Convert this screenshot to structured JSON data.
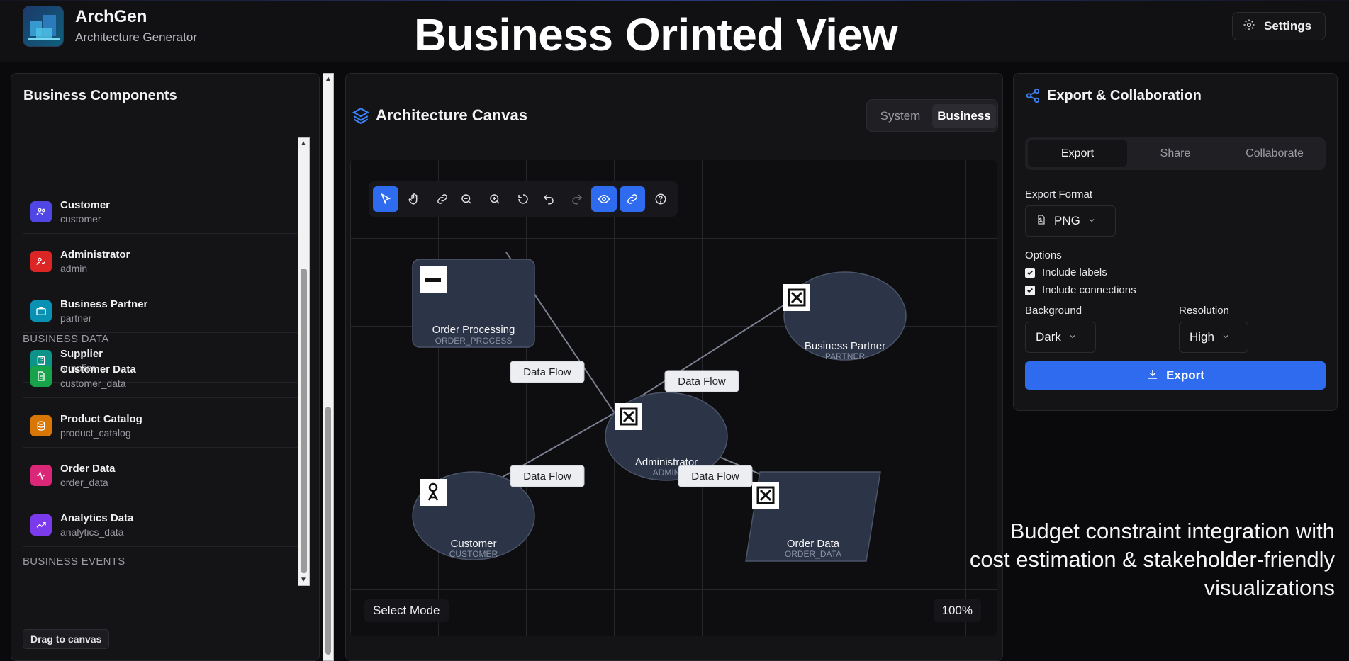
{
  "header": {
    "app_name": "ArchGen",
    "app_subtitle": "Architecture Generator",
    "hero_title": "Business Orinted View",
    "settings_label": "Settings"
  },
  "left_panel": {
    "title": "Business Components",
    "items": [
      {
        "name": "Customer",
        "id": "customer",
        "icon": "users-icon",
        "color": "#4f46e5"
      },
      {
        "name": "Administrator",
        "id": "admin",
        "icon": "user-check-icon",
        "color": "#dc2626"
      },
      {
        "name": "Business Partner",
        "id": "partner",
        "icon": "briefcase-icon",
        "color": "#0891b2"
      },
      {
        "name": "Supplier",
        "id": "supplier",
        "icon": "building-icon",
        "color": "#0d9488"
      }
    ],
    "data_section_label": "BUSINESS DATA",
    "data_items": [
      {
        "name": "Customer Data",
        "id": "customer_data",
        "icon": "file-icon",
        "color": "#16a34a"
      },
      {
        "name": "Product Catalog",
        "id": "product_catalog",
        "icon": "database-icon",
        "color": "#d97706"
      },
      {
        "name": "Order Data",
        "id": "order_data",
        "icon": "activity-icon",
        "color": "#db2777"
      },
      {
        "name": "Analytics Data",
        "id": "analytics_data",
        "icon": "trending-up-icon",
        "color": "#7c3aed"
      }
    ],
    "events_section_label": "BUSINESS EVENTS",
    "drag_hint": "Drag to canvas"
  },
  "canvas": {
    "title": "Architecture Canvas",
    "view_options": [
      "System",
      "Business"
    ],
    "active_view": "Business",
    "mode_label": "Select Mode",
    "zoom_label": "100%",
    "nodes": [
      {
        "label": "Order Processing",
        "sub": "ORDER_PROCESS",
        "shape": "rectangle"
      },
      {
        "label": "Business Partner",
        "sub": "PARTNER",
        "shape": "ellipse"
      },
      {
        "label": "Administrator",
        "sub": "ADMIN",
        "shape": "ellipse"
      },
      {
        "label": "Customer",
        "sub": "CUSTOMER",
        "shape": "ellipse"
      },
      {
        "label": "Order Data",
        "sub": "ORDER_DATA",
        "shape": "parallelogram"
      }
    ],
    "edge_label": "Data Flow"
  },
  "right_panel": {
    "title": "Export & Collaboration",
    "tabs": [
      "Export",
      "Share",
      "Collaborate"
    ],
    "active_tab": "Export",
    "export_format_label": "Export Format",
    "export_format_value": "PNG",
    "options_label": "Options",
    "option_labels": [
      "Include labels",
      "Include connections"
    ],
    "option_checked": [
      true,
      true
    ],
    "background_label": "Background",
    "background_value": "Dark",
    "resolution_label": "Resolution",
    "resolution_value": "High",
    "export_button": "Export"
  },
  "tagline": "Budget constraint integration with cost estimation & stakeholder-friendly visualizations",
  "colors": {
    "accent": "#2f6bef",
    "node_fill": "#2c3447",
    "background": "#0a0a0c"
  }
}
